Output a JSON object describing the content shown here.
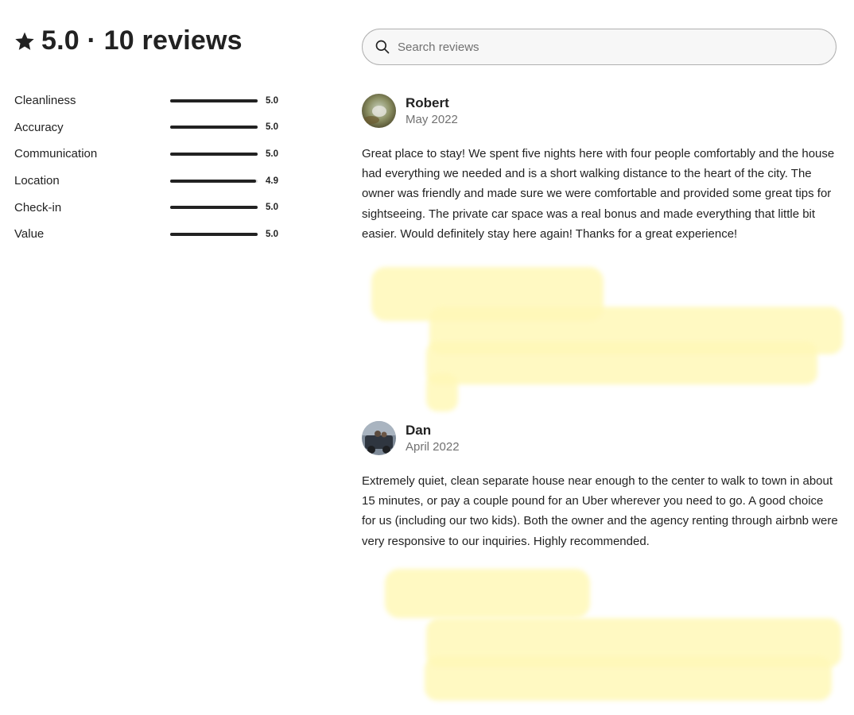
{
  "summary": {
    "text": "5.0 · 10 reviews",
    "icon": "star-icon"
  },
  "ratings": [
    {
      "label": "Cleanliness",
      "score": "5.0",
      "fraction": 1.0
    },
    {
      "label": "Accuracy",
      "score": "5.0",
      "fraction": 1.0
    },
    {
      "label": "Communication",
      "score": "5.0",
      "fraction": 1.0
    },
    {
      "label": "Location",
      "score": "4.9",
      "fraction": 0.98
    },
    {
      "label": "Check-in",
      "score": "5.0",
      "fraction": 1.0
    },
    {
      "label": "Value",
      "score": "5.0",
      "fraction": 1.0
    }
  ],
  "search": {
    "placeholder": "Search reviews",
    "value": "",
    "icon": "search-icon"
  },
  "reviews": [
    {
      "name": "Robert",
      "date": "May 2022",
      "text": "Great place to stay! We spent five nights here with four people comfortably and the house had everything we needed and is a short walking distance to the heart of the city. The owner was friendly and made sure we were comfortable and provided some great tips for sightseeing. The private car space was a real bonus and made everything that little bit easier. Would definitely stay here again! Thanks for a great experience!"
    },
    {
      "name": "Dan",
      "date": "April 2022",
      "text": "Extremely quiet, clean separate house near enough to the center to walk to town in about 15 minutes, or pay a couple pound for an Uber wherever you need to go. A good choice for us (including our two kids). Both the owner and the agency renting through airbnb were very responsive to our inquiries. Highly recommended."
    }
  ],
  "colors": {
    "text": "#222222",
    "muted": "#717171",
    "highlight": "#fff8b8"
  }
}
